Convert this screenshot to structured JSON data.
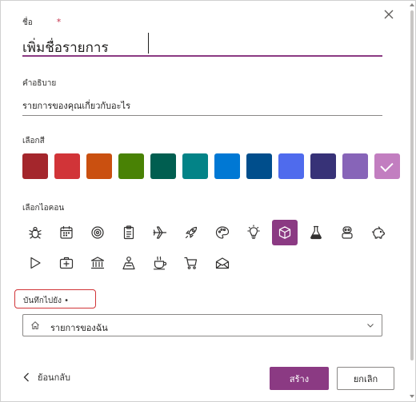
{
  "name_field": {
    "label": "ชื่อ",
    "required_mark": "*",
    "value": "เพิ่มชื่อรายการ"
  },
  "description_field": {
    "label": "คำอธิบาย",
    "value": "รายการของคุณเกี่ยวกับอะไร"
  },
  "color_picker": {
    "label": "เลือกสี",
    "selected_index": 11,
    "colors": [
      "#a4262c",
      "#d13438",
      "#ca5010",
      "#498205",
      "#005e50",
      "#038387",
      "#0078d4",
      "#004e8c",
      "#4f6bed",
      "#373277",
      "#8764b8",
      "#c27ec0"
    ]
  },
  "icon_picker": {
    "label": "เลือกไอคอน",
    "selected_index": 8,
    "icons": [
      "bug-icon",
      "calendar-icon",
      "target-icon",
      "clipboard-icon",
      "airplane-icon",
      "rocket-icon",
      "palette-icon",
      "lightbulb-icon",
      "cube-icon",
      "flask-icon",
      "robot-icon",
      "piggy-bank-icon",
      "play-icon",
      "first-aid-icon",
      "bank-icon",
      "map-pin-icon",
      "coffee-cup-icon",
      "shopping-cart-icon",
      "mail-icon"
    ]
  },
  "save_to": {
    "label": "บันทึกไปยัง •",
    "selected": "รายการของฉัน",
    "icon": "home-icon"
  },
  "footer": {
    "back_label": "ย้อนกลับ",
    "create_label": "สร้าง",
    "cancel_label": "ยกเลิก"
  },
  "accent_color": "#8b3a83"
}
